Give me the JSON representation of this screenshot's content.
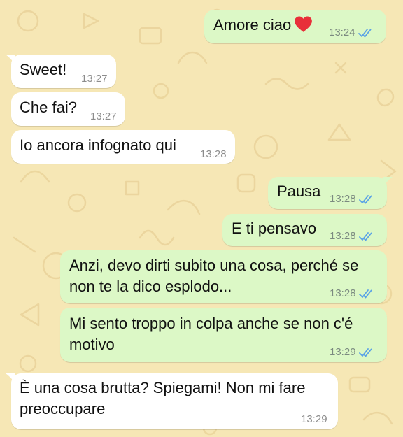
{
  "theme": {
    "wallpaper": "#f6e7b5",
    "outgoing_bubble": "#dcf8c6",
    "incoming_bubble": "#ffffff",
    "read_ticks": "#5aa2e6"
  },
  "messages": [
    {
      "direction": "outgoing",
      "text": "Amore ciao",
      "emoji": "red-heart",
      "time": "13:24",
      "status": "read"
    },
    {
      "direction": "incoming",
      "text": "Sweet!",
      "time": "13:27"
    },
    {
      "direction": "incoming",
      "text": "Che fai?",
      "time": "13:27"
    },
    {
      "direction": "incoming",
      "text": "Io ancora infognato qui",
      "time": "13:28"
    },
    {
      "direction": "outgoing",
      "text": "Pausa",
      "time": "13:28",
      "status": "read"
    },
    {
      "direction": "outgoing",
      "text": "E ti pensavo",
      "time": "13:28",
      "status": "read"
    },
    {
      "direction": "outgoing",
      "text": "Anzi, devo dirti subito una cosa, perché se non te la dico esplodo...",
      "time": "13:28",
      "status": "read"
    },
    {
      "direction": "outgoing",
      "text": "Mi sento troppo in colpa anche se non c'é motivo",
      "time": "13:29",
      "status": "read"
    },
    {
      "direction": "incoming",
      "text": "È una cosa brutta? Spiegami! Non mi fare preoccupare",
      "time": "13:29"
    }
  ]
}
